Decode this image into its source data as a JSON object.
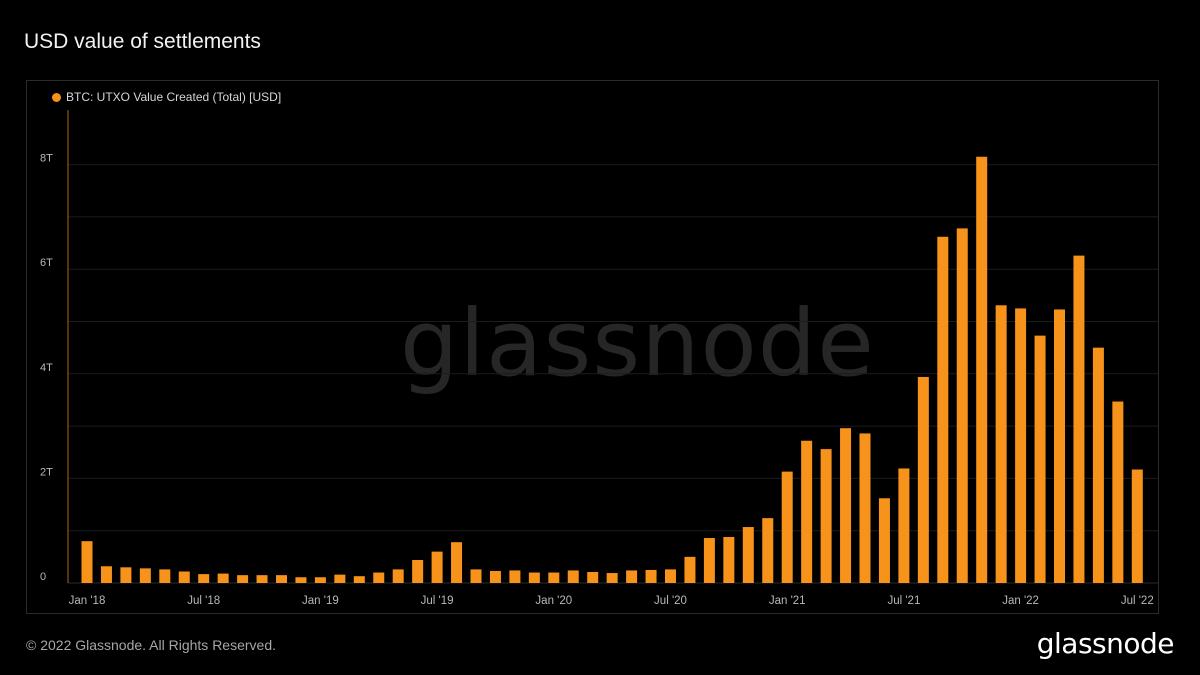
{
  "page": {
    "title": "USD value of settlements",
    "watermark": "glassnode",
    "footer": "© 2022 Glassnode. All Rights Reserved.",
    "logo": "glassnode"
  },
  "chart_data": {
    "type": "bar",
    "legend": {
      "label": "BTC: UTXO Value Created (Total) [USD]",
      "color": "#f7931a",
      "placement": "top-left"
    },
    "y_ticks": [
      {
        "value": 0,
        "label": "0"
      },
      {
        "value": 2,
        "label": "2T"
      },
      {
        "value": 4,
        "label": "4T"
      },
      {
        "value": 6,
        "label": "6T"
      },
      {
        "value": 8,
        "label": "8T"
      }
    ],
    "ylim": [
      0,
      9
    ],
    "y_unit": "T",
    "grid": true,
    "x_ticks": [
      {
        "index": 0,
        "label": "Jan '18"
      },
      {
        "index": 6,
        "label": "Jul '18"
      },
      {
        "index": 12,
        "label": "Jan '19"
      },
      {
        "index": 18,
        "label": "Jul '19"
      },
      {
        "index": 24,
        "label": "Jan '20"
      },
      {
        "index": 30,
        "label": "Jul '20"
      },
      {
        "index": 36,
        "label": "Jan '21"
      },
      {
        "index": 42,
        "label": "Jul '21"
      },
      {
        "index": 48,
        "label": "Jan '22"
      },
      {
        "index": 54,
        "label": "Jul '22"
      }
    ],
    "categories": [
      "Jan '18",
      "Feb '18",
      "Mar '18",
      "Apr '18",
      "May '18",
      "Jun '18",
      "Jul '18",
      "Aug '18",
      "Sep '18",
      "Oct '18",
      "Nov '18",
      "Dec '18",
      "Jan '19",
      "Feb '19",
      "Mar '19",
      "Apr '19",
      "May '19",
      "Jun '19",
      "Jul '19",
      "Aug '19",
      "Sep '19",
      "Oct '19",
      "Nov '19",
      "Dec '19",
      "Jan '20",
      "Feb '20",
      "Mar '20",
      "Apr '20",
      "May '20",
      "Jun '20",
      "Jul '20",
      "Aug '20",
      "Sep '20",
      "Oct '20",
      "Nov '20",
      "Dec '20",
      "Jan '21",
      "Feb '21",
      "Mar '21",
      "Apr '21",
      "May '21",
      "Jun '21",
      "Jul '21",
      "Aug '21",
      "Sep '21",
      "Oct '21",
      "Nov '21",
      "Dec '21",
      "Jan '22",
      "Feb '22",
      "Mar '22",
      "Apr '22",
      "May '22",
      "Jun '22",
      "Jul '22"
    ],
    "values": [
      0.8,
      0.32,
      0.3,
      0.28,
      0.26,
      0.22,
      0.17,
      0.18,
      0.15,
      0.15,
      0.15,
      0.11,
      0.11,
      0.16,
      0.13,
      0.2,
      0.26,
      0.44,
      0.6,
      0.78,
      0.26,
      0.23,
      0.24,
      0.2,
      0.2,
      0.24,
      0.21,
      0.19,
      0.24,
      0.25,
      0.26,
      0.5,
      0.86,
      0.88,
      1.07,
      1.24,
      2.13,
      2.72,
      2.56,
      2.96,
      2.86,
      1.62,
      2.19,
      3.94,
      6.62,
      6.78,
      8.15,
      5.31,
      5.25,
      4.73,
      5.23,
      6.26,
      4.5,
      3.47,
      2.17
    ],
    "bar_color": "#f7931a"
  }
}
